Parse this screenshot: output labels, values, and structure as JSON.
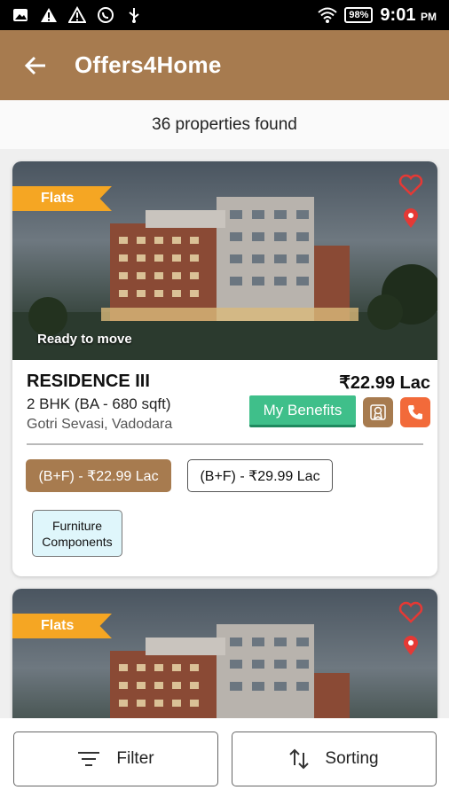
{
  "status_bar": {
    "left_icons": [
      "photo-icon",
      "alert-icon",
      "warning-icon",
      "whatsapp-icon",
      "usb-icon"
    ],
    "battery": "98%",
    "time": "9:01",
    "ampm": "PM"
  },
  "app_bar": {
    "title": "Offers4Home"
  },
  "results": {
    "count_text": "36 properties found"
  },
  "listings": [
    {
      "tag": "Flats",
      "status_label": "Ready to move",
      "name": "RESIDENCE III",
      "price": "₹22.99 Lac",
      "config": "2 BHK  (BA - 680 sqft)",
      "location": "Gotri Sevasi, Vadodara",
      "benefits_label": "My Benefits",
      "price_options": [
        "(B+F) - ₹22.99 Lac",
        "(B+F) - ₹29.99 Lac"
      ],
      "feature_line1": "Furniture",
      "feature_line2": "Components"
    },
    {
      "tag": "Flats"
    }
  ],
  "bottom_bar": {
    "filter_label": "Filter",
    "sort_label": "Sorting"
  },
  "colors": {
    "brand": "#a77b4f",
    "ribbon": "#f5a623",
    "benefits": "#3fbf8a",
    "call": "#f26a3a",
    "heart": "#e53935"
  }
}
